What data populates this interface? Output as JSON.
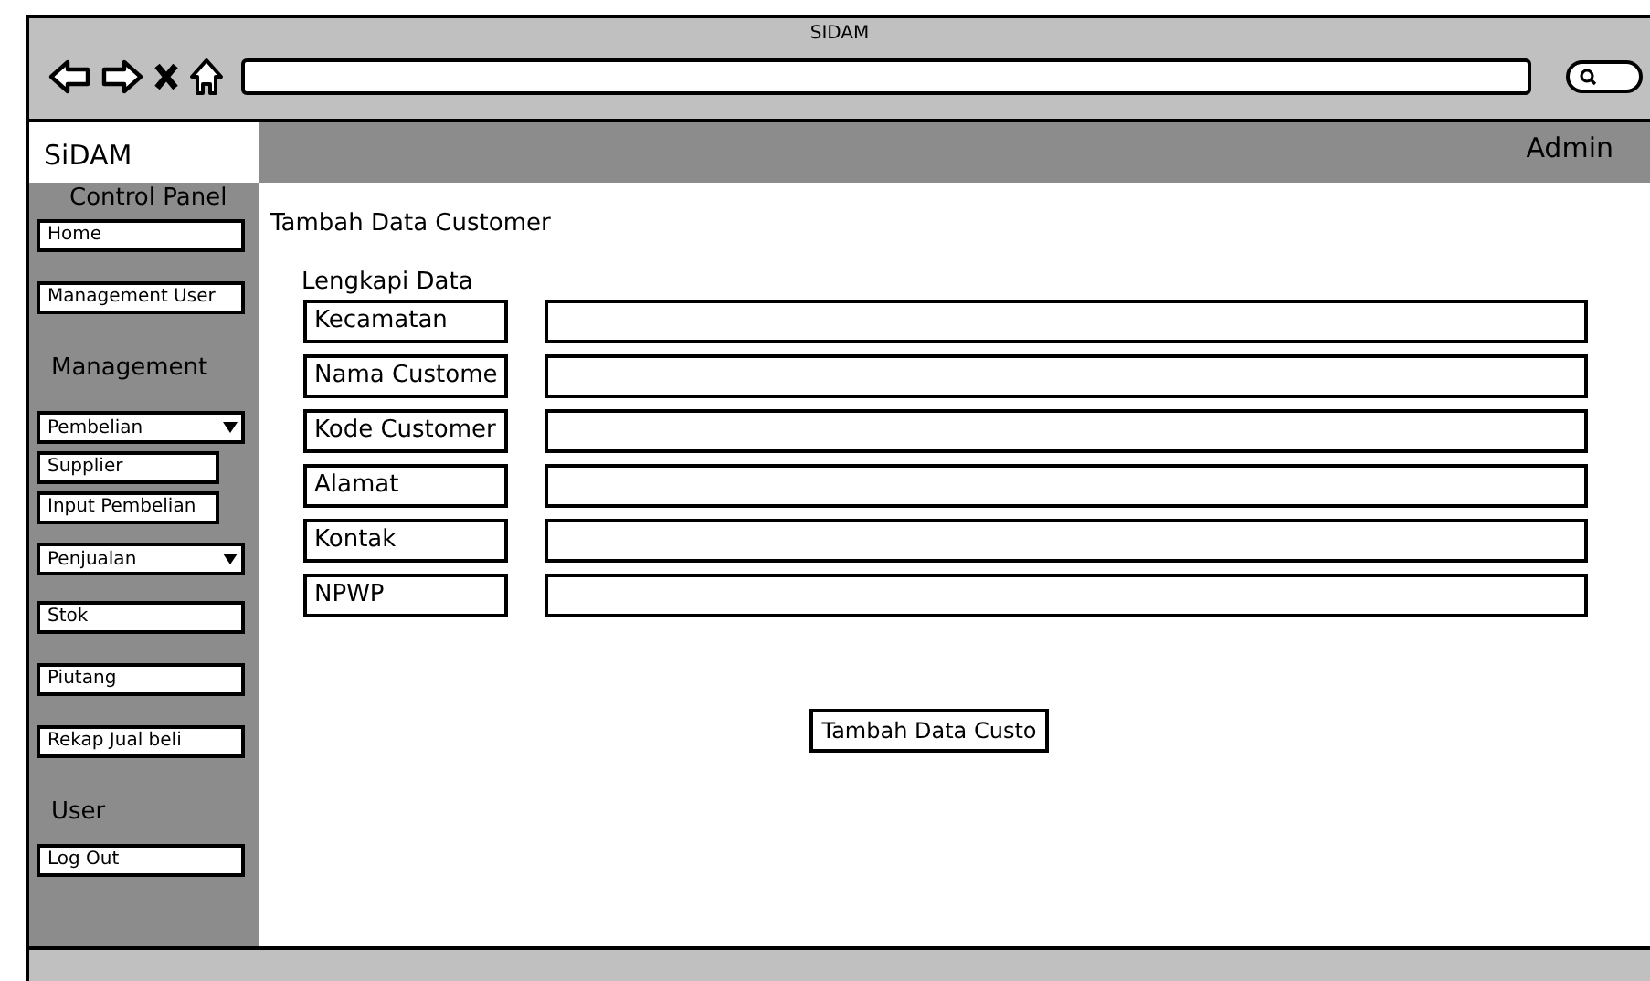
{
  "window": {
    "title": "SIDAM"
  },
  "header": {
    "brand": "SiDAM",
    "user": "Admin"
  },
  "sidebar": {
    "items": [
      {
        "kind": "header",
        "label": "Control Panel"
      },
      {
        "kind": "link",
        "label": "Home"
      },
      {
        "kind": "link",
        "label": "Management User"
      },
      {
        "kind": "header",
        "label": "Management"
      },
      {
        "kind": "dropdown",
        "label": "Pembelian"
      },
      {
        "kind": "sublink",
        "label": "Supplier"
      },
      {
        "kind": "sublink",
        "label": "Input Pembelian"
      },
      {
        "kind": "dropdown",
        "label": "Penjualan"
      },
      {
        "kind": "link",
        "label": "Stok"
      },
      {
        "kind": "link",
        "label": "Piutang"
      },
      {
        "kind": "link",
        "label": "Rekap Jual beli"
      },
      {
        "kind": "header",
        "label": "User"
      },
      {
        "kind": "link",
        "label": "Log Out"
      }
    ]
  },
  "page": {
    "title": "Tambah Data Customer",
    "subtitle": "Lengkapi Data",
    "fields": [
      {
        "label": "Kecamatan"
      },
      {
        "label": "Nama Custome"
      },
      {
        "label": "Kode Customer"
      },
      {
        "label": "Alamat"
      },
      {
        "label": "Kontak"
      },
      {
        "label": "NPWP"
      }
    ],
    "submit": "Tambah Data Custo"
  }
}
